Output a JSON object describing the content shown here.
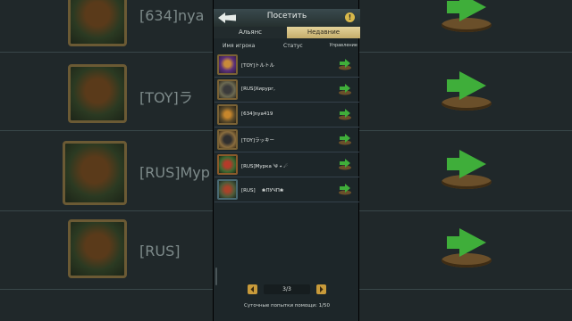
{
  "background": {
    "rows": [
      {
        "label": "[634]nya"
      },
      {
        "label": "[TOY]ラ"
      },
      {
        "label": "[RUS]Myp"
      },
      {
        "label": "[RUS]"
      }
    ]
  },
  "header": {
    "title": "Посетить",
    "info_symbol": "!"
  },
  "tabs": [
    {
      "label": "Альянс",
      "active": false
    },
    {
      "label": "Недавние",
      "active": true
    }
  ],
  "columns": {
    "name": "Имя игрока",
    "status": "Статус",
    "manage": "Управление"
  },
  "players": [
    {
      "name": "[TOY]トルトル"
    },
    {
      "name": "[RUS]Хирург,"
    },
    {
      "name": "[634]nya419"
    },
    {
      "name": "[TOY]ラッキー"
    },
    {
      "name": "[RUS]Мурка ༄ ٭ ☄"
    },
    {
      "name": "[RUS] 　❀ПУЧП❀"
    }
  ],
  "pager": {
    "label": "3/3"
  },
  "footer": {
    "daily_attempts": "Суточные попытки помощи: 1/50"
  },
  "colors": {
    "accent": "#d8b84a",
    "go_arrow": "#3fae3a",
    "panel_bg": "#1d2629"
  }
}
